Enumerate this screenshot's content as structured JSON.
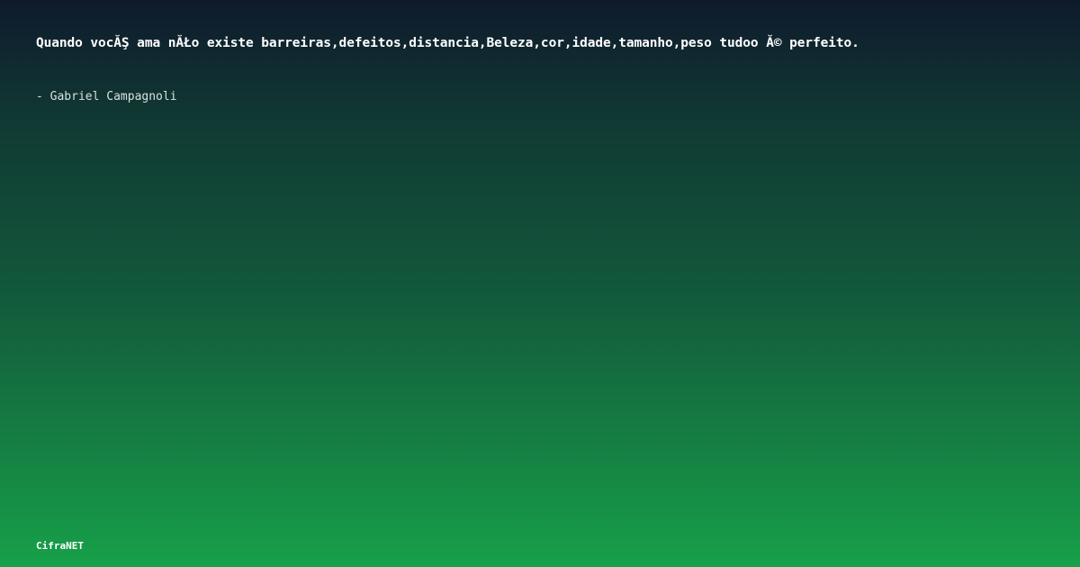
{
  "quote": {
    "text": "Quando vocĂŞ ama nĂŁo existe barreiras,defeitos,distancia,Beleza,cor,idade,tamanho,peso tudoo Ă© perfeito.",
    "author": "- Gabriel Campagnoli"
  },
  "brand": {
    "name": "CifraNET"
  },
  "colors": {
    "gradient_top": "#0f1a2c",
    "gradient_bottom": "#17a049",
    "text": "#ffffff"
  }
}
